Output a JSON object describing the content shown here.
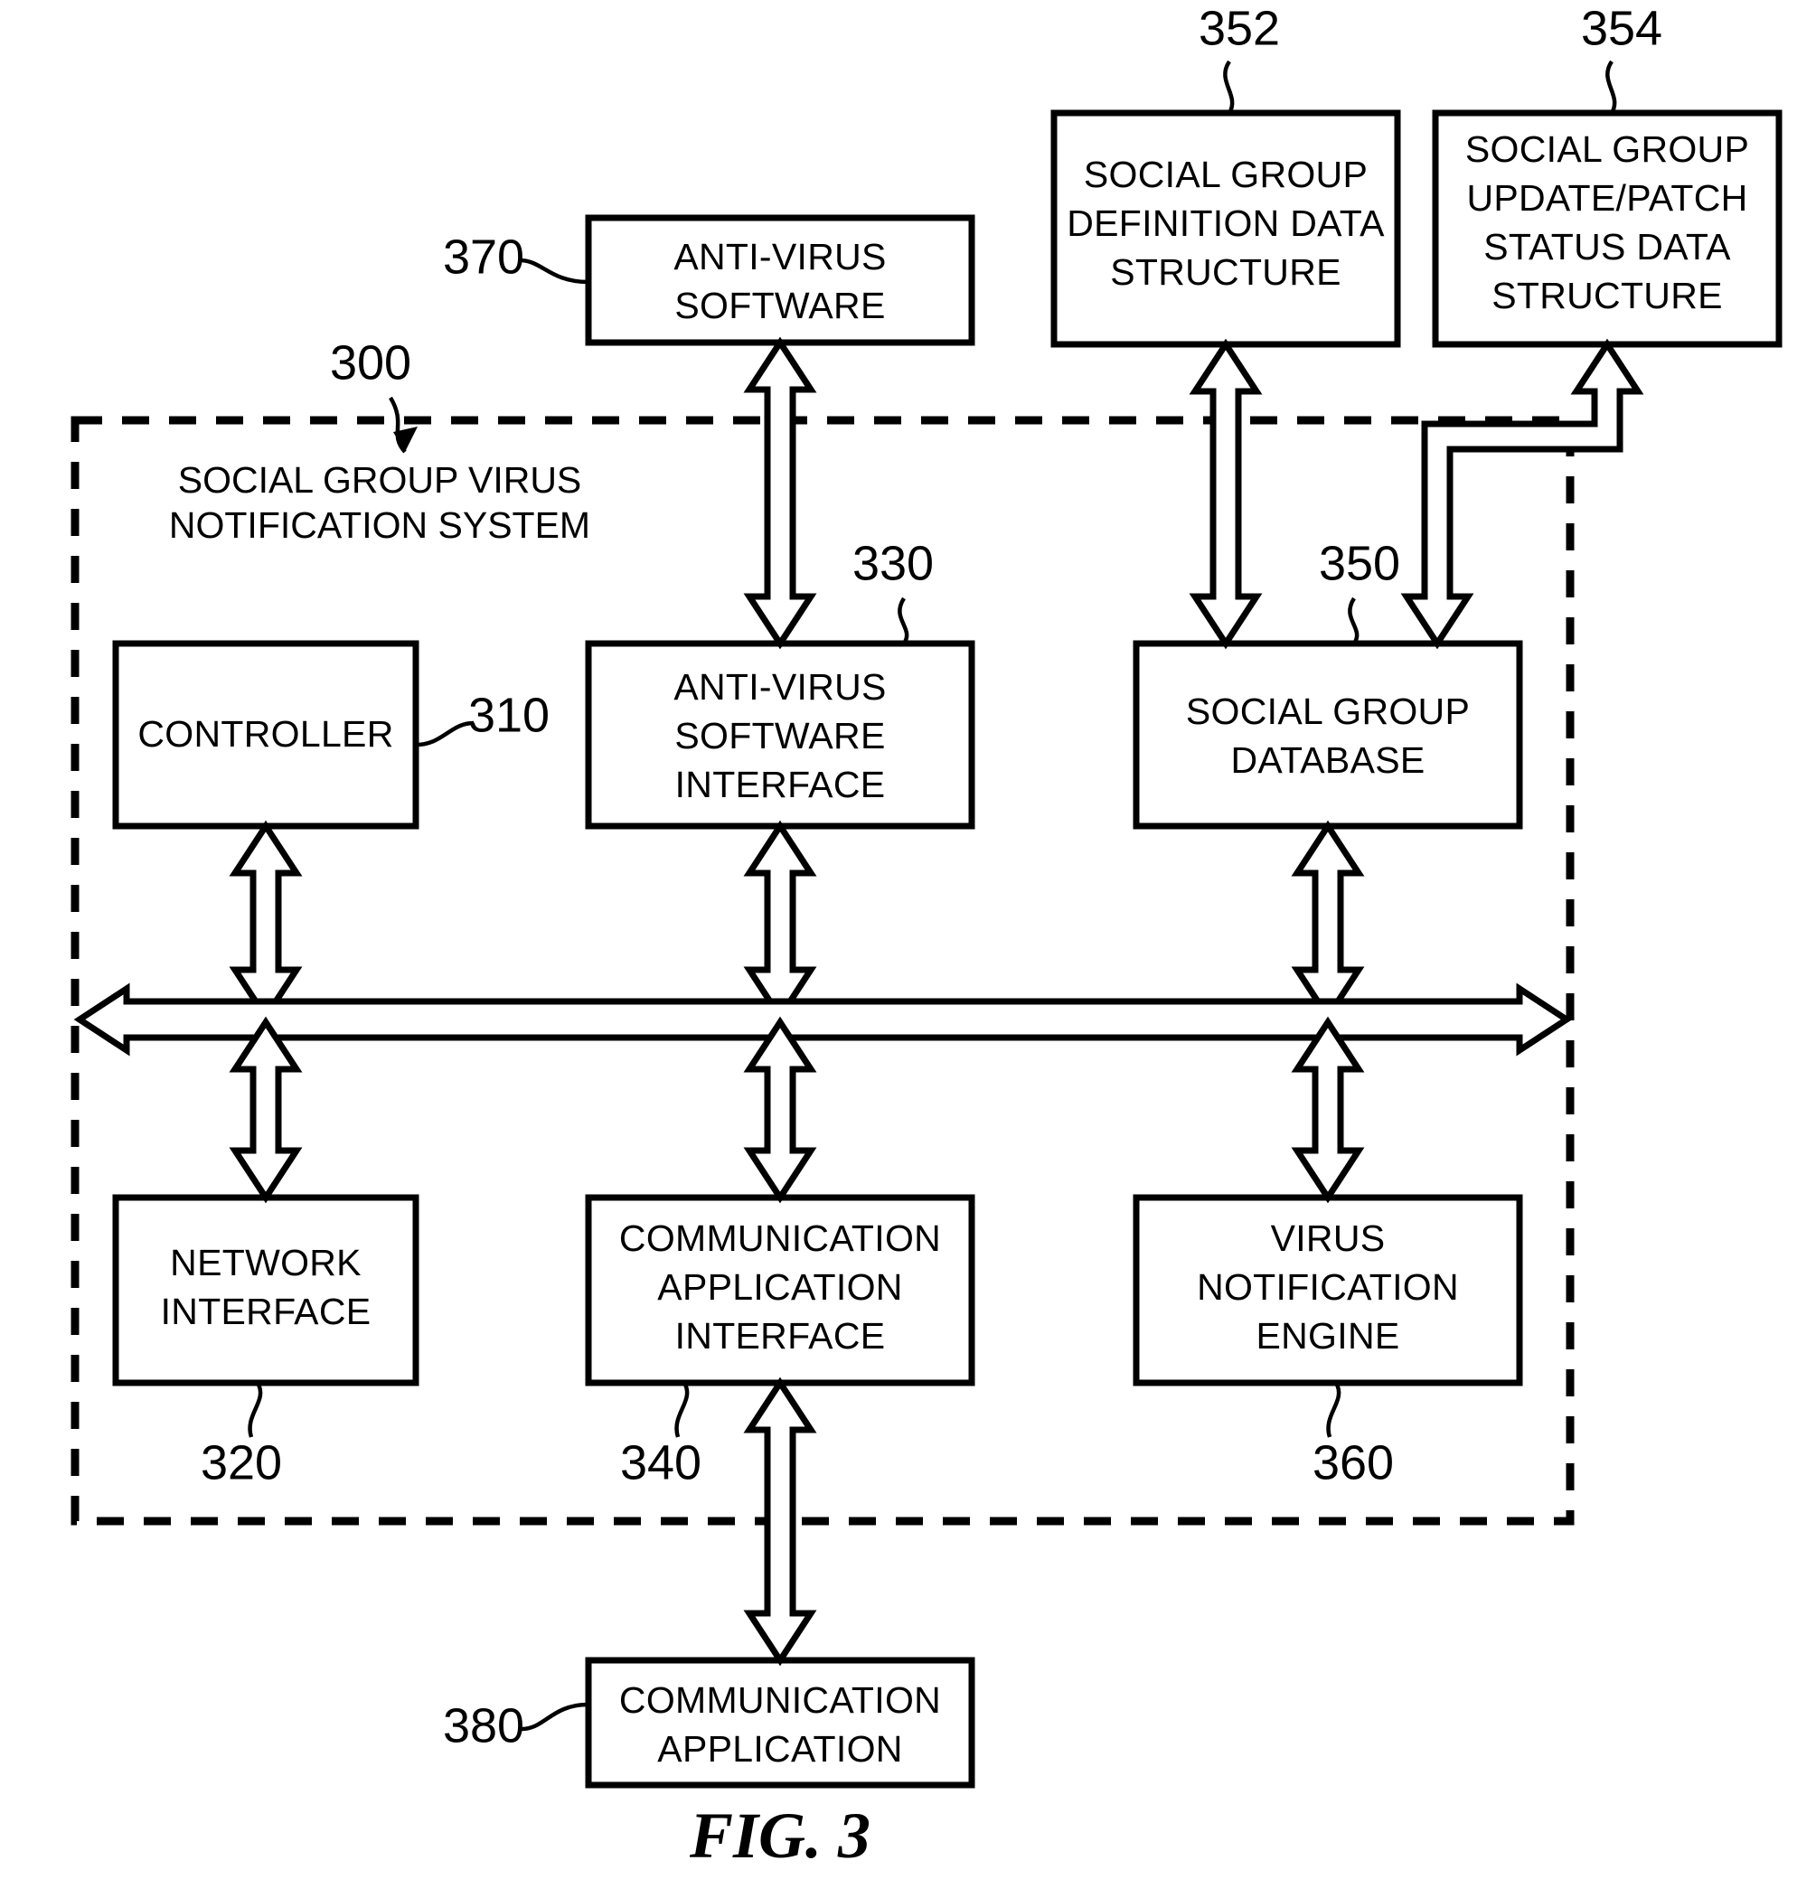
{
  "figure": {
    "caption": "FIG. 3",
    "system_title_line1": "SOCIAL GROUP VIRUS",
    "system_title_line2": "NOTIFICATION SYSTEM",
    "system_ref": "300"
  },
  "boxes": {
    "anti_virus_software": {
      "ref": "370",
      "line1": "ANTI-VIRUS",
      "line2": "SOFTWARE"
    },
    "social_group_definition": {
      "ref": "352",
      "line1": "SOCIAL GROUP",
      "line2": "DEFINITION DATA",
      "line3": "STRUCTURE"
    },
    "social_group_update_patch": {
      "ref": "354",
      "line1": "SOCIAL GROUP",
      "line2": "UPDATE/PATCH",
      "line3": "STATUS DATA",
      "line4": "STRUCTURE"
    },
    "controller": {
      "ref": "310",
      "line1": "CONTROLLER"
    },
    "anti_virus_software_interface": {
      "ref": "330",
      "line1": "ANTI-VIRUS",
      "line2": "SOFTWARE",
      "line3": "INTERFACE"
    },
    "social_group_database": {
      "ref": "350",
      "line1": "SOCIAL GROUP",
      "line2": "DATABASE"
    },
    "network_interface": {
      "ref": "320",
      "line1": "NETWORK",
      "line2": "INTERFACE"
    },
    "communication_application_interface": {
      "ref": "340",
      "line1": "COMMUNICATION",
      "line2": "APPLICATION",
      "line3": "INTERFACE"
    },
    "virus_notification_engine": {
      "ref": "360",
      "line1": "VIRUS",
      "line2": "NOTIFICATION",
      "line3": "ENGINE"
    },
    "communication_application": {
      "ref": "380",
      "line1": "COMMUNICATION",
      "line2": "APPLICATION"
    }
  },
  "colors": {
    "stroke": "#000000",
    "fill": "#ffffff"
  }
}
